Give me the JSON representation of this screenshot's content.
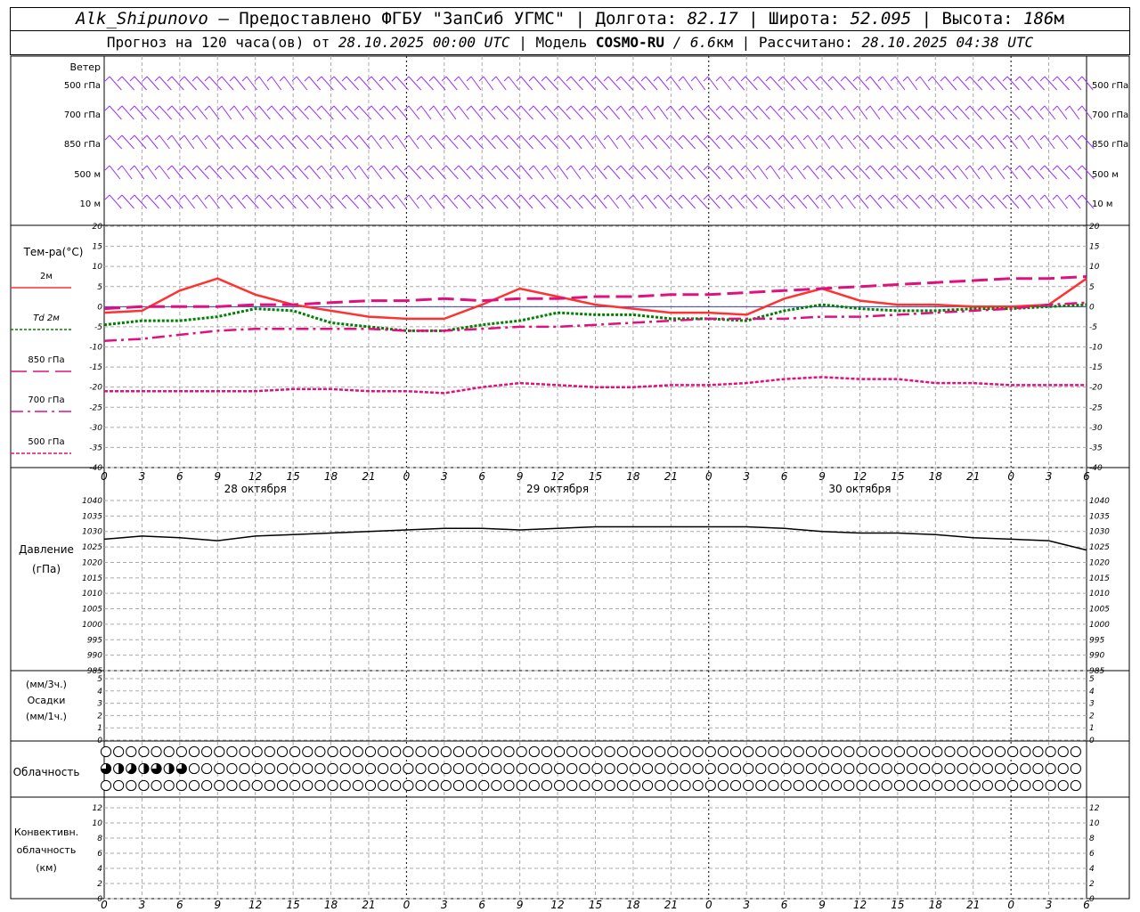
{
  "header": {
    "station": "Alk_Shipunovo",
    "provided_by": " – Предоставлено ФГБУ \"ЗапСиб УГМС\" | Долгота: ",
    "lon": "82.17",
    "lat_label": " | Широта: ",
    "lat": "52.095",
    "alt_label": " | Высота: ",
    "alt": "186",
    "alt_unit": "м",
    "forecast_label": "Прогноз на 120 часа(ов) от ",
    "forecast_start": "28.10.2025 00:00 UTC",
    "model_label": " | Модель ",
    "model": "COSMO-RU",
    "res": " / 6.6",
    "res_unit": "км",
    "calc_label": " | Рассчитано: ",
    "calc_time": "28.10.2025 04:38 UTC"
  },
  "colors": {
    "wind": "#9b30ff",
    "t2m": "#ff3232",
    "td2m": "#008000",
    "t850": "#e0107e",
    "t700": "#e0107e",
    "t500": "#e0107e",
    "pressure": "#000000",
    "grid": "#aaaaaa"
  },
  "wind_panel": {
    "title": "Ветер",
    "levels": [
      "500 гПа",
      "700 гПа",
      "850 гПа",
      "500 м",
      "10  м"
    ]
  },
  "temp_panel": {
    "title": "Тем-ра(°C)",
    "legend": [
      {
        "label": "2м",
        "key": "t2m",
        "dash": ""
      },
      {
        "label": "Td  2м",
        "key": "td2m",
        "dash": "3,2"
      },
      {
        "label": "850 гПа",
        "key": "t850",
        "dash": "18,7"
      },
      {
        "label": "700 гПа",
        "key": "t700",
        "dash": "14,5,3,5"
      },
      {
        "label": "500 гПа",
        "key": "t500",
        "dash": "4,2"
      }
    ],
    "y_ticks": [
      "20",
      "15",
      "10",
      "5",
      "0",
      "-5",
      "-10",
      "-15",
      "-20",
      "-25",
      "-30",
      "-35",
      "-40"
    ]
  },
  "time_axis": {
    "hour_ticks": [
      "0",
      "3",
      "6",
      "9",
      "12",
      "15",
      "18",
      "21",
      "0",
      "3",
      "6",
      "9",
      "12",
      "15",
      "18",
      "21",
      "0",
      "3",
      "6",
      "9",
      "12",
      "15",
      "18",
      "21",
      "0",
      "3",
      "6"
    ],
    "days": [
      "28 октября",
      "29 октября",
      "30 октября"
    ]
  },
  "pressure_panel": {
    "title1": "Давление",
    "title2": "(гПа)",
    "y_ticks": [
      "1040",
      "1035",
      "1030",
      "1025",
      "1020",
      "1015",
      "1010",
      "1005",
      "1000",
      "995",
      "990",
      "985"
    ]
  },
  "precip_panel": {
    "line1": "(мм/3ч.)",
    "line2": "Осадки",
    "line3": "(мм/1ч.)",
    "y_ticks": [
      "5",
      "4",
      "3",
      "2",
      "1",
      "0"
    ]
  },
  "cloud_panel": {
    "title": "Облачность"
  },
  "conv_panel": {
    "line1": "Конвективн.",
    "line2": "облачность",
    "line3": "(км)",
    "y_ticks": [
      "12",
      "10",
      "8",
      "6",
      "4",
      "2",
      "0"
    ]
  },
  "chart_data": {
    "type": "line",
    "x_hours": [
      0,
      3,
      6,
      9,
      12,
      15,
      18,
      21,
      24,
      27,
      30,
      33,
      36,
      39,
      42,
      45,
      48,
      51,
      54,
      57,
      60,
      63,
      66,
      69,
      72,
      75,
      78
    ],
    "temperature": {
      "ylim": [
        -40,
        20
      ],
      "series": [
        {
          "name": "2м",
          "values": [
            -1.5,
            -1,
            4,
            7,
            3,
            0.5,
            -1,
            -2.5,
            -3,
            -3,
            0.5,
            4.5,
            2.5,
            0.5,
            -0.5,
            -1.5,
            -1.5,
            -2,
            2,
            4.5,
            1.5,
            0.5,
            0.5,
            0,
            0,
            0.5,
            7
          ]
        },
        {
          "name": "Td  2м",
          "values": [
            -4.5,
            -3.5,
            -3.5,
            -2.5,
            -0.5,
            -1,
            -4,
            -5,
            -6,
            -6,
            -4.5,
            -3.5,
            -1.5,
            -2,
            -2,
            -3,
            -3,
            -3.5,
            -1,
            0.5,
            -0.5,
            -1,
            -1,
            -0.5,
            -0.5,
            0,
            0.5
          ]
        },
        {
          "name": "850 гПа",
          "values": [
            -0.5,
            0,
            0,
            0,
            0.5,
            0.5,
            1,
            1.5,
            1.5,
            2,
            1.5,
            2,
            2,
            2.5,
            2.5,
            3,
            3,
            3.5,
            4,
            4.5,
            5,
            5.5,
            6,
            6.5,
            7,
            7,
            7.5
          ]
        },
        {
          "name": "700 гПа",
          "values": [
            -8.5,
            -8,
            -7,
            -6,
            -5.5,
            -5.5,
            -5.5,
            -5.5,
            -6,
            -6,
            -5.5,
            -5,
            -5,
            -4.5,
            -4,
            -3.5,
            -3,
            -3,
            -3,
            -2.5,
            -2.5,
            -2,
            -1.5,
            -1,
            -0.5,
            0.5,
            1
          ]
        },
        {
          "name": "500 гПа",
          "values": [
            -21,
            -21,
            -21,
            -21,
            -21,
            -20.5,
            -20.5,
            -21,
            -21,
            -21.5,
            -20,
            -19,
            -19.5,
            -20,
            -20,
            -19.5,
            -19.5,
            -19,
            -18,
            -17.5,
            -18,
            -18,
            -19,
            -19,
            -19.5,
            -19.5,
            -19.5
          ]
        }
      ]
    },
    "pressure": {
      "ylim": [
        985,
        1040
      ],
      "values": [
        1027.5,
        1028.5,
        1028,
        1027,
        1028.5,
        1029,
        1029.5,
        1030,
        1030.5,
        1031,
        1031,
        1030.5,
        1031,
        1031.5,
        1031.5,
        1031.5,
        1031.5,
        1031.5,
        1031,
        1030,
        1029.5,
        1029.5,
        1029,
        1028,
        1027.5,
        1027,
        1024
      ]
    },
    "precipitation": {
      "ylim": [
        0,
        5
      ],
      "values": [
        0,
        0,
        0,
        0,
        0,
        0,
        0,
        0,
        0,
        0,
        0,
        0,
        0,
        0,
        0,
        0,
        0,
        0,
        0,
        0,
        0,
        0,
        0,
        0,
        0,
        0,
        0
      ]
    },
    "cloud_cover": {
      "rows": [
        "upper",
        "middle",
        "low"
      ],
      "upper": [
        0,
        0,
        0,
        0,
        0,
        0,
        0,
        0,
        0,
        0,
        0,
        0,
        0,
        0,
        0,
        0,
        0,
        0,
        0,
        0,
        0,
        0,
        0,
        0,
        0,
        0,
        0,
        0,
        0,
        0,
        0,
        0,
        0,
        0,
        0,
        0,
        0,
        0,
        0,
        0,
        0,
        0,
        0,
        0,
        0,
        0,
        0,
        0,
        0,
        0,
        0,
        0,
        0,
        0,
        0,
        0,
        0,
        0,
        0,
        0,
        0,
        0,
        0,
        0,
        0,
        0,
        0,
        0,
        0,
        0,
        0,
        0,
        0,
        0,
        0,
        0,
        0,
        0,
        0
      ],
      "middle": [
        6,
        4,
        5,
        4,
        6,
        4,
        6,
        0,
        0,
        0,
        0,
        0,
        0,
        0,
        0,
        0,
        0,
        0,
        0,
        0,
        0,
        0,
        0,
        0,
        0,
        0,
        0,
        0,
        0,
        0,
        0,
        0,
        0,
        0,
        0,
        0,
        0,
        0,
        0,
        0,
        0,
        0,
        0,
        0,
        0,
        0,
        0,
        0,
        0,
        0,
        0,
        0,
        0,
        0,
        0,
        0,
        0,
        0,
        0,
        0,
        0,
        0,
        0,
        0,
        0,
        0,
        0,
        0,
        0,
        0,
        0,
        0,
        0,
        0,
        0,
        0,
        0,
        0,
        0
      ],
      "high": [
        0,
        0,
        0,
        0,
        0,
        0,
        0,
        0,
        0,
        0,
        0,
        0,
        0,
        0,
        0,
        0,
        0,
        0,
        0,
        0,
        0,
        0,
        0,
        0,
        0,
        0,
        0,
        0,
        0,
        0,
        0,
        0,
        0,
        0,
        0,
        0,
        0,
        0,
        0,
        0,
        0,
        0,
        0,
        0,
        0,
        0,
        0,
        0,
        0,
        0,
        0,
        0,
        0,
        0,
        0,
        0,
        0,
        0,
        0,
        0,
        0,
        0,
        0,
        0,
        0,
        0,
        0,
        0,
        0,
        0,
        0,
        0,
        0,
        0,
        0,
        0,
        0,
        0,
        0
      ]
    },
    "convective_cloud": {
      "ylim": [
        0,
        13
      ],
      "values": []
    }
  }
}
